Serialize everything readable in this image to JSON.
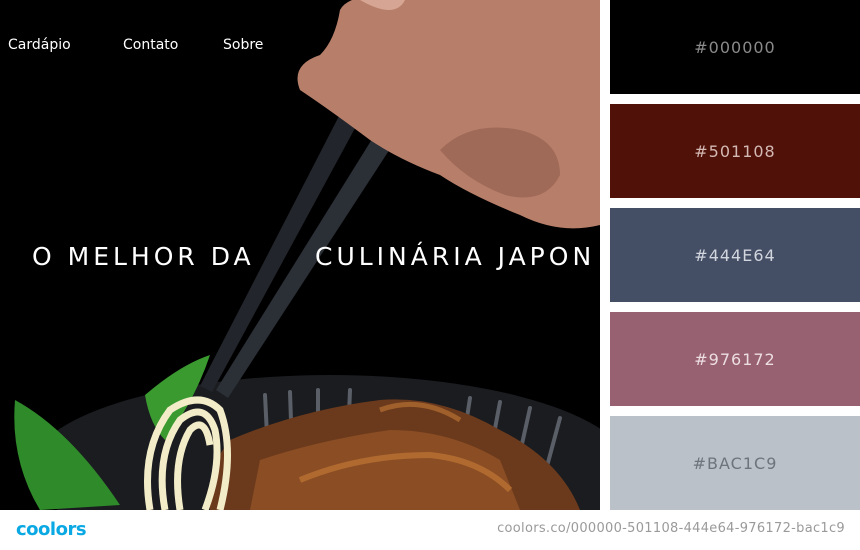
{
  "hero": {
    "nav": [
      {
        "label": "Cardápio"
      },
      {
        "label": "Contato"
      },
      {
        "label": "Sobre"
      }
    ],
    "headline_part1": "O MELHOR DA",
    "headline_part2": "CULINÁRIA JAPON"
  },
  "palette": {
    "swatches": [
      {
        "hex": "#000000",
        "label": "#000000",
        "text_color": "#8a8a8a"
      },
      {
        "hex": "#501108",
        "label": "#501108",
        "text_color": "#d4b9b4"
      },
      {
        "hex": "#444E64",
        "label": "#444E64",
        "text_color": "#d2d6de"
      },
      {
        "hex": "#976172",
        "label": "#976172",
        "text_color": "#ecdde1"
      },
      {
        "hex": "#BAC1C9",
        "label": "#BAC1C9",
        "text_color": "#6e747b"
      }
    ]
  },
  "footer": {
    "logo": "coolors",
    "url": "coolors.co/000000-501108-444e64-976172-bac1c9"
  }
}
